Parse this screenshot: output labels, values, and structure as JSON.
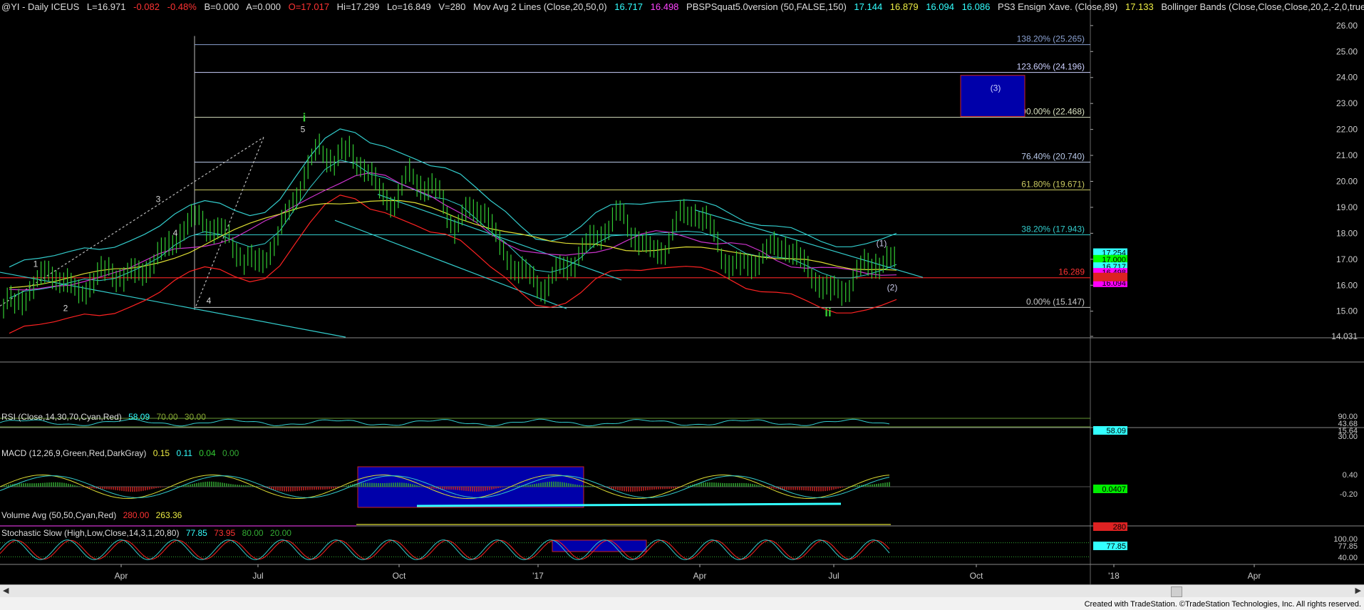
{
  "header": {
    "symbol": "@YI - Daily  ICEUS",
    "last": "L=16.971",
    "change": "-0.082",
    "pct": "-0.48%",
    "bid": "B=0.000",
    "ask": "A=0.000",
    "open": "O=17.017",
    "high": "Hi=17.299",
    "low": "Lo=16.849",
    "vol": "V=280",
    "ma_label": "Mov Avg 2 Lines (Close,20,50,0)",
    "ma1": "16.717",
    "ma2": "16.498",
    "pbs_label": "PBSPSquat5.0version (50,FALSE,150)",
    "pbs1": "17.144",
    "pbs2": "16.879",
    "pbs3": "16.094",
    "pbs4": "16.086",
    "ens_label": "PS3 Ensign Xave. (Close,89)",
    "ens1": "17.133",
    "bb_label": "Bollinger Bands (Close,Close,Close,20,2,-2,0,true ..."
  },
  "colors": {
    "bg": "#000000",
    "price_bar": "#33cc33",
    "grid": "#808080",
    "cyan": "#33cccc",
    "red": "#ff2222",
    "magenta": "#cc33cc",
    "yellow": "#dddd33",
    "wave_green": "#33cc33",
    "blue_box": "#0000aa"
  },
  "chart_data": {
    "type": "line",
    "title": "@YI - Daily ICEUS",
    "x_tick_labels": [
      "Apr",
      "Jul",
      "Oct",
      "'17",
      "Apr",
      "Jul",
      "Oct",
      "'18",
      "Apr"
    ],
    "y_ticks": [
      "26.00",
      "25.00",
      "24.00",
      "23.00",
      "22.00",
      "21.00",
      "20.00",
      "19.00",
      "18.00",
      "17.00",
      "16.00",
      "15.00",
      "14.031"
    ],
    "ylim": [
      14.031,
      26.6
    ],
    "fib_levels": [
      {
        "label": "138.20% (25.265)",
        "value": 25.265,
        "color": "#8aa0d0"
      },
      {
        "label": "123.60% (24.196)",
        "value": 24.196,
        "color": "#ccd0ff"
      },
      {
        "label": "100.00% (22.468)",
        "value": 22.468,
        "color": "#d8e0c0"
      },
      {
        "label": "76.40% (20.740)",
        "value": 20.74,
        "color": "#b8c8e8"
      },
      {
        "label": "61.80% (19.671)",
        "value": 19.671,
        "color": "#c8c860"
      },
      {
        "label": "38.20% (17.943)",
        "value": 17.943,
        "color": "#33cccc"
      },
      {
        "label": "0.00% (15.147)",
        "value": 15.147,
        "color": "#c8c8c8"
      }
    ],
    "right_tags": [
      {
        "text": "17.254",
        "value": 17.254,
        "bg": "#33ffff",
        "fg": "#000000"
      },
      {
        "text": "17.000",
        "value": 17.0,
        "bg": "#00ff00",
        "fg": "#000000"
      },
      {
        "text": "16.717",
        "value": 16.717,
        "bg": "#33ffff",
        "fg": "#000000"
      },
      {
        "text": "16.498",
        "value": 16.498,
        "bg": "#ff00ff",
        "fg": "#000000"
      },
      {
        "text": "16.094",
        "value": 16.094,
        "bg": "#ff00ff",
        "fg": "#000000"
      }
    ],
    "support_line": {
      "label": "16.289",
      "value": 16.289
    },
    "close_series": [
      15.2,
      15.4,
      15.9,
      16.6,
      16.1,
      15.7,
      16.2,
      16.6,
      16.3,
      16.5,
      16.9,
      17.5,
      18.2,
      18.6,
      18.2,
      17.8,
      17.0,
      16.8,
      17.6,
      18.8,
      20.3,
      21.2,
      20.9,
      21.1,
      20.6,
      19.6,
      19.2,
      20.2,
      19.9,
      19.4,
      18.3,
      18.8,
      19.0,
      17.4,
      16.8,
      16.2,
      16.0,
      16.5,
      17.0,
      17.6,
      18.2,
      18.7,
      18.0,
      17.2,
      17.5,
      18.6,
      18.9,
      18.2,
      17.0,
      16.6,
      17.0,
      17.3,
      17.6,
      16.9,
      16.3,
      15.7,
      15.9,
      16.6,
      16.9,
      16.9
    ],
    "bull_box": {
      "label": "(3)",
      "y_top": 24.0,
      "y_bottom": 22.5
    },
    "wave_labels": [
      {
        "text": "1",
        "value": 16.7,
        "color": "#d8d8d8"
      },
      {
        "text": "2",
        "value": 15.0,
        "color": "#d8d8d8"
      },
      {
        "text": "3",
        "value": 19.2,
        "color": "#d8d8d8"
      },
      {
        "text": "4",
        "value": 17.9,
        "color": "#d8d8d8"
      },
      {
        "text": "4",
        "value": 15.3,
        "color": "#d8d8d8"
      },
      {
        "text": "5",
        "value": 21.9,
        "color": "#d8d8d8"
      },
      {
        "text": "i",
        "value": 22.3,
        "color": "#33cc33"
      },
      {
        "text": "ii",
        "value": 14.8,
        "color": "#33cc33"
      },
      {
        "text": "(1)",
        "value": 17.5,
        "color": "#c8c8e8"
      },
      {
        "text": "(2)",
        "value": 15.8,
        "color": "#c8c8e8"
      }
    ]
  },
  "rsi": {
    "label": "RSI (Close,14,30,70,Cyan,Red)",
    "v1": "58.09",
    "v2": "70.00",
    "v3": "30.00",
    "ticks": [
      "90.00",
      "43.68",
      "15.64",
      "30.00"
    ],
    "tag": "58.09"
  },
  "macd": {
    "label": "MACD (12,26,9,Green,Red,DarkGray)",
    "v1": "0.15",
    "v2": "0.11",
    "v3": "0.04",
    "v4": "0.00",
    "ticks": [
      "0.40",
      "-0.20"
    ],
    "tag": "0.0407"
  },
  "volume": {
    "label": "Volume Avg (50,50,Cyan,Red)",
    "v1": "280.00",
    "v2": "263.36",
    "tag": "280"
  },
  "stoch": {
    "label": "Stochastic Slow (High,Low,Close,14,3,1,20,80)",
    "v1": "77.85",
    "v2": "73.95",
    "v3": "80.00",
    "v4": "20.00",
    "ticks": [
      "100.00",
      "77.85",
      "40.00"
    ],
    "tag": "77.85"
  },
  "footer": {
    "text": "Created with TradeStation. ©TradeStation Technologies, Inc. All rights reserved."
  }
}
